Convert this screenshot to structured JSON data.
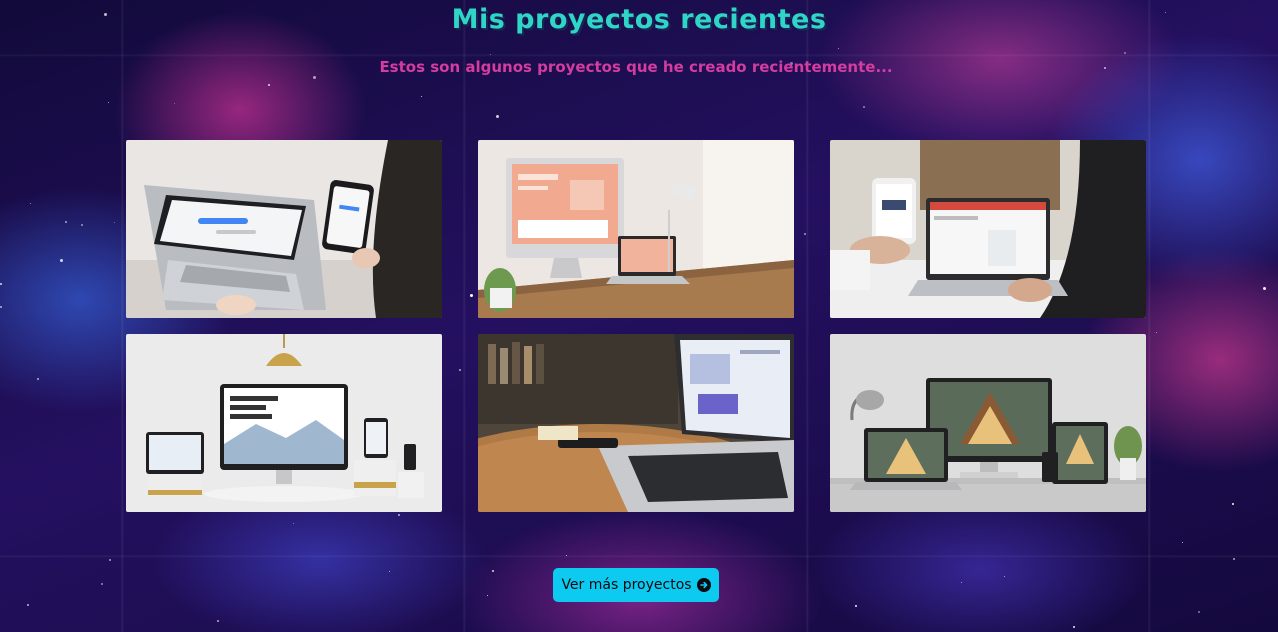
{
  "header": {
    "title": "Mis proyectos recientes",
    "subtitle": "Estos son algunos proyectos que he creado recientemente..."
  },
  "projects": [
    {
      "alt": "Laptop con Google y móvil"
    },
    {
      "alt": "Escritorio con iMac, laptop y tablet"
    },
    {
      "alt": "Manos con móvil y laptop"
    },
    {
      "alt": "Responsive web design en varios dispositivos"
    },
    {
      "alt": "Laptop sobre mesa de madera"
    },
    {
      "alt": "Sitio de arquitectura en varios dispositivos"
    }
  ],
  "cta": {
    "label": "Ver más proyectos",
    "icon": "arrow-right-circle-icon",
    "color": "#0dcaf0"
  },
  "colors": {
    "title": "#2fd6c8",
    "subtitle": "#d43ca0",
    "background": "#1a0f4a"
  }
}
